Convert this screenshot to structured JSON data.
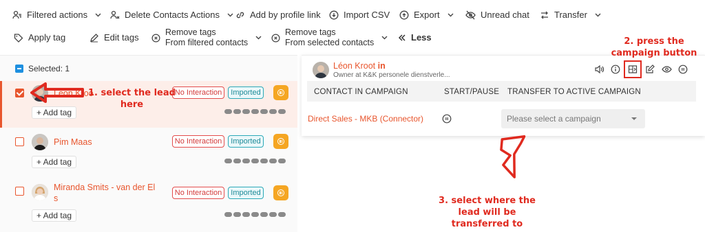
{
  "toolbar": {
    "filtered_actions": "Filtered actions",
    "delete_contacts_actions": "Delete Contacts Actions",
    "add_by_profile_link": "Add by profile link",
    "import_csv": "Import CSV",
    "export": "Export",
    "unread_chat": "Unread chat",
    "transfer": "Transfer",
    "apply_tag": "Apply tag",
    "edit_tags": "Edit tags",
    "remove_tags_filtered_1": "Remove tags",
    "remove_tags_filtered_2": "From filtered contacts",
    "remove_tags_selected_1": "Remove tags",
    "remove_tags_selected_2": "From selected contacts",
    "less": "Less"
  },
  "selection": {
    "label": "Selected: 1"
  },
  "leads": [
    {
      "name": "Léon Kroot",
      "name_visible": "Leon Kroo",
      "checked": true,
      "tags": [
        "No Interaction",
        "Imported"
      ],
      "add_tag": "+ Add tag"
    },
    {
      "name": "Pim Maas",
      "checked": false,
      "tags": [
        "No Interaction",
        "Imported"
      ],
      "add_tag": "+ Add tag"
    },
    {
      "name_line1": "Miranda Smits - van der El",
      "name_line2": "s",
      "checked": false,
      "tags": [
        "No Interaction",
        "Imported"
      ],
      "add_tag": "+ Add tag"
    }
  ],
  "contact": {
    "name": "Léon Kroot",
    "linkedin": "in",
    "subtitle": "Owner at K&K personele dienstverle..."
  },
  "campaign_table": {
    "headers": [
      "CONTACT IN CAMPAIGN",
      "START/PAUSE",
      "TRANSFER TO ACTIVE CAMPAIGN"
    ],
    "rows": [
      {
        "campaign": "Direct Sales - MKB (Connector)",
        "placeholder": "Please select a campaign"
      }
    ]
  },
  "annotations": {
    "step1_line1": "1. select the lead",
    "step1_line2": "here",
    "step2_line1": "2. press the",
    "step2_line2": "campaign button",
    "step3_line1": "3. select where the",
    "step3_line2": "lead will be",
    "step3_line3": "transferred to"
  },
  "colors": {
    "accent": "#e8552d",
    "annotation": "#e02a1f",
    "badge_red": "#e34c4c",
    "badge_teal": "#2ca9b8",
    "pause": "#f5a623"
  }
}
